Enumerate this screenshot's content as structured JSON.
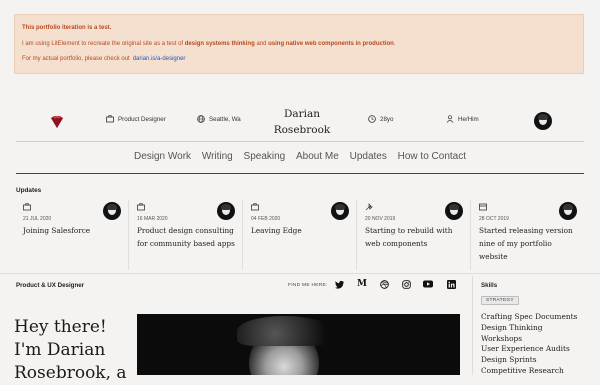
{
  "banner": {
    "line1": "This portfolio iteration is a test.",
    "line2_a": "I am using LitElement to recreate the original site as a test of ",
    "line2_b": "design systems thinking",
    "line2_c": " and ",
    "line2_d": "using native web components in production",
    "line2_e": ".",
    "line3_a": "For my actual portfolio, please check out",
    "line3_link": "darian.is/a-designer"
  },
  "header": {
    "role": "Product Designer",
    "location": "Seattle, Wa",
    "name": "Darian Rosebrook",
    "age": "28yo",
    "pronouns": "He/Him"
  },
  "nav": [
    "Design Work",
    "Writing",
    "Speaking",
    "About Me",
    "Updates",
    "How to Contact"
  ],
  "updates": {
    "title": "Updates",
    "items": [
      {
        "icon": "briefcase-icon",
        "date": "21 JUL 2020",
        "title": "Joining Salesforce"
      },
      {
        "icon": "briefcase-icon",
        "date": "16 MAR 2020",
        "title": "Product design consulting for community based apps"
      },
      {
        "icon": "briefcase-icon",
        "date": "04 FEB 2020",
        "title": "Leaving Edge"
      },
      {
        "icon": "sparkle-icon",
        "date": "20 NOV 2019",
        "title": "Starting to rebuild with web components"
      },
      {
        "icon": "browser-icon",
        "date": "28 OCT 2019",
        "title": "Started releasing version nine of my portfolio website"
      }
    ]
  },
  "intro": {
    "section_label": "Product & UX Designer",
    "find_me_label": "FIND ME HERE:",
    "social_icons": [
      "twitter-icon",
      "medium-icon",
      "dribbble-icon",
      "instagram-icon",
      "youtube-icon",
      "linkedin-icon"
    ],
    "hero_text": "Hey there! I'm Darian Rosebrook, a"
  },
  "skills": {
    "title": "Skills",
    "tag": "STRATEGY",
    "items": [
      "Crafting Spec Documents",
      "Design Thinking",
      "Workshops",
      "User Experience Audits",
      "Design Sprints",
      "Competitive Research"
    ]
  }
}
